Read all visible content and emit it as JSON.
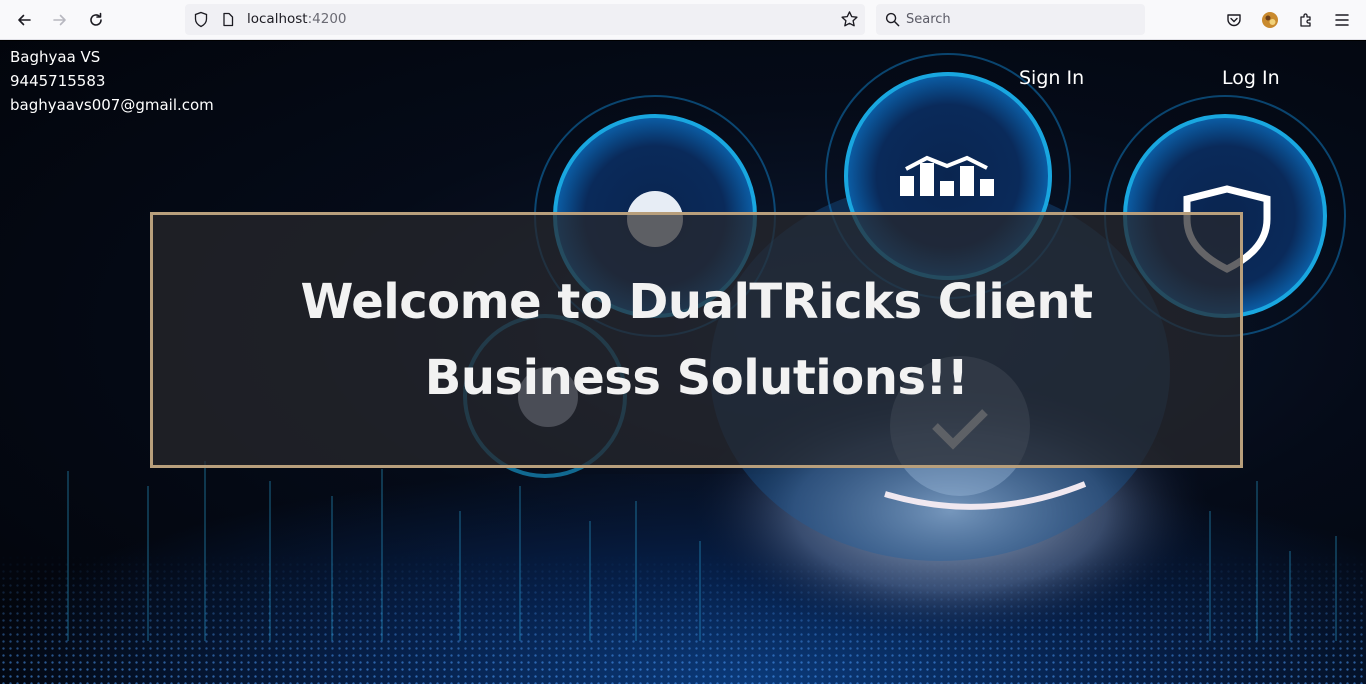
{
  "browser": {
    "url_host": "localhost",
    "url_port": ":4200",
    "search_placeholder": "Search"
  },
  "contact": {
    "name": "Baghyaa VS",
    "phone": "9445715583",
    "email": "baghyaavs007@gmail.com"
  },
  "nav": {
    "sign_in": "Sign In",
    "log_in": "Log In"
  },
  "hero": {
    "title": "Welcome to DualTRicks Client Business Solutions!!"
  },
  "colors": {
    "box_border": "#b89f7c",
    "accent_cyan": "#19a7e0"
  }
}
